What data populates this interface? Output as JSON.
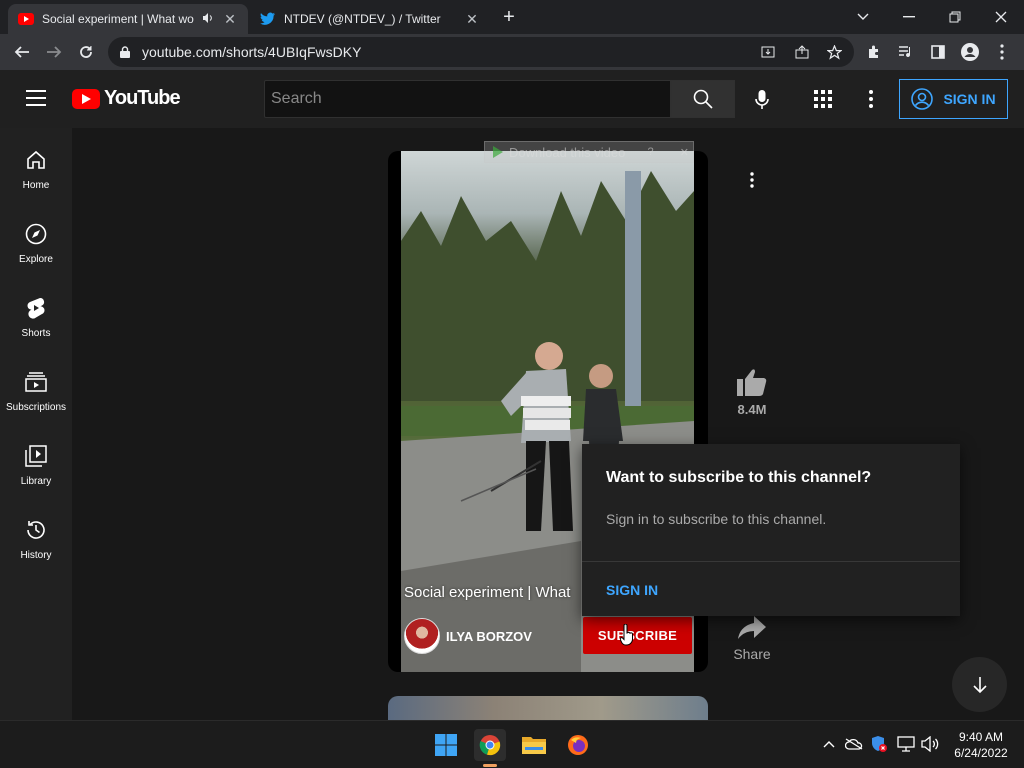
{
  "browser": {
    "tabs": [
      {
        "title": "Social experiment | What wo",
        "active": true
      },
      {
        "title": "NTDEV (@NTDEV_) / Twitter",
        "active": false
      }
    ],
    "url": "youtube.com/shorts/4UBIqFwsDKY"
  },
  "header": {
    "logo_text": "YouTube",
    "search_placeholder": "Search",
    "sign_in": "SIGN IN"
  },
  "sidebar": {
    "items": [
      {
        "label": "Home",
        "icon": "home-icon"
      },
      {
        "label": "Explore",
        "icon": "compass-icon"
      },
      {
        "label": "Shorts",
        "icon": "shorts-icon"
      },
      {
        "label": "Subscriptions",
        "icon": "subscriptions-icon"
      },
      {
        "label": "Library",
        "icon": "library-icon"
      },
      {
        "label": "History",
        "icon": "history-icon"
      }
    ]
  },
  "short": {
    "title": "Social experiment | What",
    "channel": "ILYA BORZOV",
    "subscribe": "SUBSCRIBE",
    "likes": "8.4M",
    "share": "Share",
    "download_overlay": "Download this video"
  },
  "popup": {
    "heading": "Want to subscribe to this channel?",
    "description": "Sign in to subscribe to this channel.",
    "sign_in": "SIGN IN"
  },
  "taskbar": {
    "time": "9:40 AM",
    "date": "6/24/2022"
  },
  "colors": {
    "accent_blue": "#3ea6ff",
    "youtube_red": "#ff0000",
    "subscribe_red": "#cc0000"
  }
}
